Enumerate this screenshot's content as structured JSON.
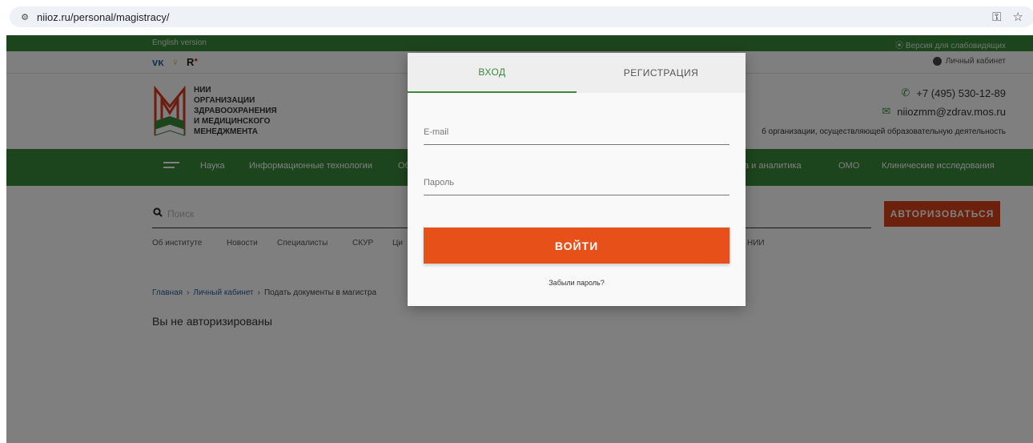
{
  "browser": {
    "url": "niioz.ru/personal/magistracy/"
  },
  "topbar": {
    "english": "English version",
    "vision": "⦿ Версия для слабовидящих"
  },
  "social": {
    "vk": "vk",
    "ok": "ok",
    "r": "R",
    "cabinet": "Личный кабинет"
  },
  "header": {
    "logo_lines": [
      "НИИ",
      "ОРГАНИЗАЦИИ",
      "ЗДРАВООХРАНЕНИЯ",
      "И МЕДИЦИНСКОГО",
      "МЕНЕДЖМЕНТА"
    ],
    "phone": "+7 (495) 530-12-89",
    "email": "niiozmm@zdrav.mos.ru",
    "license": "б организации, осуществляющей образовательную деятельность"
  },
  "nav": {
    "items": [
      "Наука",
      "Информационные технологии",
      "Об",
      "а и аналитика",
      "ОМО",
      "Клинические исследования"
    ]
  },
  "search": {
    "placeholder": "Поиск",
    "auth_button": "АВТОРИЗОВАТЬСЯ"
  },
  "subnav": {
    "items": [
      "Об институте",
      "Новости",
      "Специалисты",
      "СКУР",
      "Ци",
      "НИИ"
    ]
  },
  "breadcrumbs": {
    "home": "Главная",
    "cabinet": "Личный кабинет",
    "current": "Подать документы в магистра"
  },
  "main": {
    "message": "Вы не авторизированы"
  },
  "modal": {
    "tab_login": "ВХОД",
    "tab_register": "РЕГИСТРАЦИЯ",
    "email_placeholder": "E-mail",
    "password_placeholder": "Пароль",
    "login_button": "ВОЙТИ",
    "forgot": "Забыли пароль?"
  },
  "colors": {
    "green": "#3a8a3a",
    "orange": "#e8501a",
    "overlay": "rgba(0,0,0,0.5)"
  }
}
